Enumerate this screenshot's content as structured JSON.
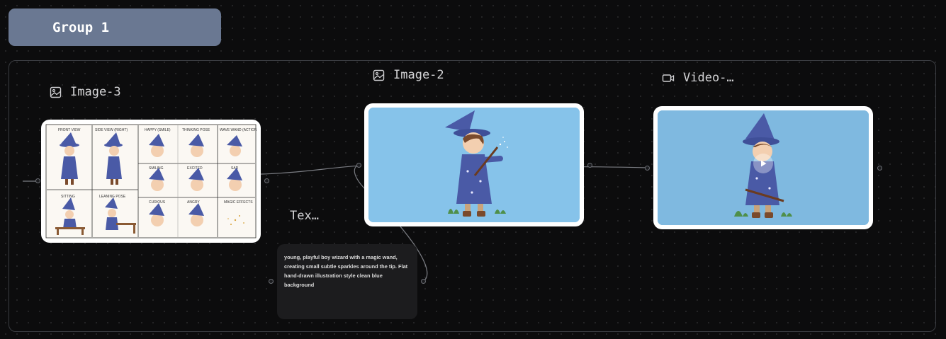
{
  "group": {
    "title": "Group 1"
  },
  "nodes": {
    "image3": {
      "label": "Image-3",
      "icon": "image-icon",
      "sheet_labels": [
        "FRONT VIEW",
        "SIDE VIEW (RIGHT)",
        "HAPPY (SMILE)",
        "THINKING POSE",
        "WAVE WAND (ACTION)",
        "SITTING",
        "CHEERING/SMILE",
        "SURPRISED",
        "SAD",
        "SITTING ON BENCH",
        "LEANING POSE",
        "CURIOUS",
        "ANGRY",
        "MAGIC EFFECTS"
      ]
    },
    "image2": {
      "label": "Image-2",
      "icon": "image-icon"
    },
    "video": {
      "label": "Video-…",
      "icon": "video-icon"
    },
    "text": {
      "label": "Tex…",
      "content": "young, playful boy wizard with a magic wand, creating small subtle sparkles around the tip. Flat hand-drawn illustration style  clean blue background"
    }
  },
  "colors": {
    "canvas_bg": "#0c0c0d",
    "group_header": "#6a7892",
    "illustration_bg": "#86c3ea",
    "robe": "#4a5aa6"
  }
}
